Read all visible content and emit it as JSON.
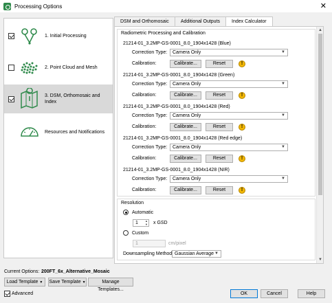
{
  "window": {
    "title": "Processing Options",
    "close_glyph": "✕"
  },
  "steps": [
    {
      "label_lines": [
        "1. Initial Processing"
      ],
      "checked": true,
      "icon": "initial-processing-icon"
    },
    {
      "label_lines": [
        "2. Point Cloud and Mesh"
      ],
      "checked": false,
      "icon": "point-cloud-icon"
    },
    {
      "label_lines": [
        "3. DSM, Orthomosaic and",
        "Index"
      ],
      "checked": true,
      "icon": "dsm-map-icon"
    },
    {
      "label_lines": [
        "Resources and Notifications"
      ],
      "checked": null,
      "icon": "gauge-icon"
    }
  ],
  "tabs": [
    "DSM and Orthomosaic",
    "Additional Outputs",
    "Index Calculator"
  ],
  "active_tab": 2,
  "radiometric": {
    "title": "Radiometric Processing and Calibration",
    "correction_label": "Correction Type:",
    "calibration_label": "Calibration:",
    "calibrate_label": "Calibrate...",
    "reset_label": "Reset",
    "warning_glyph": "!",
    "bands": [
      {
        "name": "21214-01_3.2MP-GS-0001_8.0_1904x1428 (Blue)",
        "correction": "Camera Only"
      },
      {
        "name": "21214-01_3.2MP-GS-0001_8.0_1904x1428 (Green)",
        "correction": "Camera Only"
      },
      {
        "name": "21214-01_3.2MP-GS-0001_8.0_1904x1428 (Red)",
        "correction": "Camera Only"
      },
      {
        "name": "21214-01_3.2MP-GS-0001_8.0_1904x1428 (Red edge)",
        "correction": "Camera Only"
      },
      {
        "name": "21214-01_3.2MP-GS-0001_8.0_1904x1428 (NIR)",
        "correction": "Camera Only"
      }
    ]
  },
  "resolution": {
    "title": "Resolution",
    "automatic_label": "Automatic",
    "automatic_selected": true,
    "gsd_value": "1",
    "gsd_unit": "x GSD",
    "custom_label": "Custom",
    "custom_value": "1",
    "custom_unit": "cm/pixel",
    "downsampling_label": "Downsampling Method:",
    "downsampling_value": "Gaussian Average"
  },
  "footer": {
    "current_options_label": "Current Options:",
    "current_options_value": "200FT_6x_Alternative_Mosaic",
    "load_template": "Load Template",
    "save_template": "Save Template",
    "manage_templates": "Manage Templates...",
    "advanced_label": "Advanced",
    "advanced_checked": true,
    "ok": "OK",
    "cancel": "Cancel",
    "help": "Help"
  },
  "colors": {
    "accent": "#0078d7",
    "icon_green": "#2f8a4b",
    "warning": "#f2b705"
  }
}
